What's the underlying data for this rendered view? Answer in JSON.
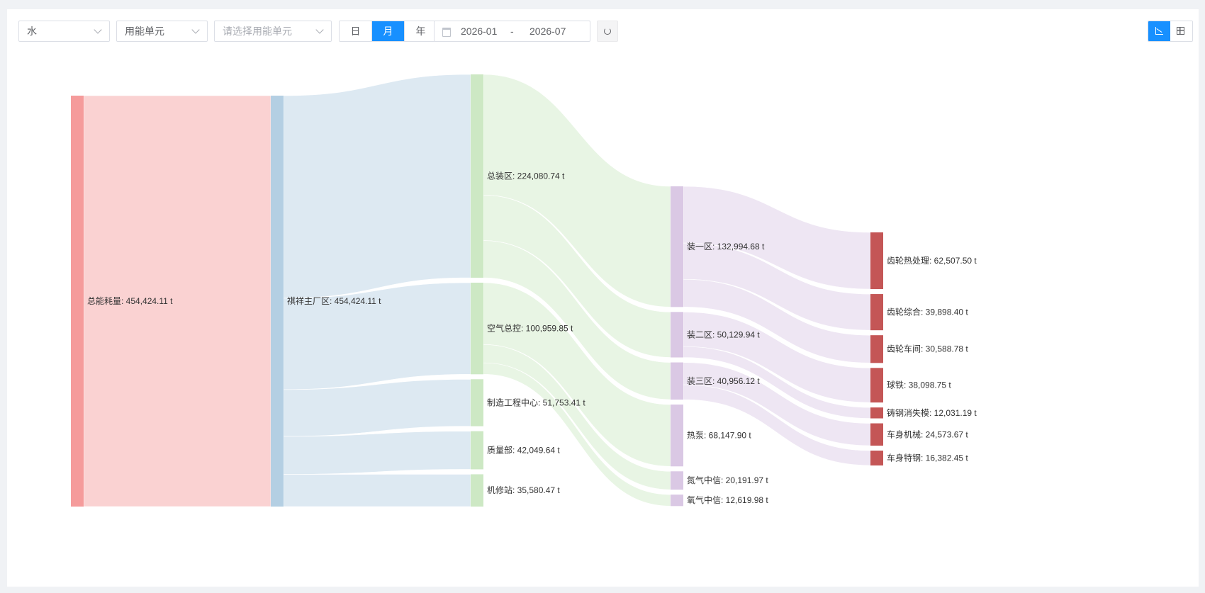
{
  "toolbar": {
    "energy_type": "水",
    "unit_type": "用能单元",
    "unit_placeholder": "请选择用能单元",
    "period_buttons": [
      "日",
      "月",
      "年"
    ],
    "active_period": "月",
    "date_start": "2026-01",
    "date_sep": "-",
    "date_end": "2026-07"
  },
  "colors": {
    "accent": "#1890ff",
    "level0": "#f59b9b",
    "level1": "#b4cfe3",
    "level2": "#cde8c4",
    "level3": "#dac8e4",
    "level4": "#c45656"
  },
  "chart_data": {
    "type": "sankey",
    "unit": "t",
    "nodes": [
      {
        "id": "total",
        "name": "总能耗量",
        "level": 0,
        "value": 454424.11,
        "label": "总能耗量: 454,424.11 t"
      },
      {
        "id": "plant",
        "name": "祺祥主厂区",
        "level": 1,
        "value": 454424.11,
        "label": "祺祥主厂区: 454,424.11 t"
      },
      {
        "id": "assembly",
        "name": "总装区",
        "level": 2,
        "value": 224080.74,
        "label": "总装区: 224,080.74 t"
      },
      {
        "id": "air",
        "name": "空气总控",
        "level": 2,
        "value": 100959.85,
        "label": "空气总控: 100,959.85 t"
      },
      {
        "id": "mfg",
        "name": "制造工程中心",
        "level": 2,
        "value": 51753.41,
        "label": "制造工程中心: 51,753.41 t"
      },
      {
        "id": "quality",
        "name": "质量部",
        "level": 2,
        "value": 42049.64,
        "label": "质量部: 42,049.64 t"
      },
      {
        "id": "repair",
        "name": "机修站",
        "level": 2,
        "value": 35580.47,
        "label": "机修站: 35,580.47 t"
      },
      {
        "id": "z1",
        "name": "装一区",
        "level": 3,
        "value": 132994.68,
        "label": "装一区: 132,994.68 t"
      },
      {
        "id": "z2",
        "name": "装二区",
        "level": 3,
        "value": 50129.94,
        "label": "装二区: 50,129.94 t"
      },
      {
        "id": "z3",
        "name": "装三区",
        "level": 3,
        "value": 40956.12,
        "label": "装三区: 40,956.12 t"
      },
      {
        "id": "pump",
        "name": "热泵",
        "level": 3,
        "value": 68147.9,
        "label": "热泵: 68,147.90 t"
      },
      {
        "id": "n2",
        "name": "氮气中信",
        "level": 3,
        "value": 20191.97,
        "label": "氮气中信: 20,191.97 t"
      },
      {
        "id": "o2",
        "name": "氧气中信",
        "level": 3,
        "value": 12619.98,
        "label": "氧气中信: 12,619.98 t"
      },
      {
        "id": "gearheat",
        "name": "齿轮热处理",
        "level": 4,
        "value": 62507.5,
        "label": "齿轮热处理: 62,507.50 t"
      },
      {
        "id": "gearall",
        "name": "齿轮综合",
        "level": 4,
        "value": 39898.4,
        "label": "齿轮综合: 39,898.40 t"
      },
      {
        "id": "gearshop",
        "name": "齿轮车间",
        "level": 4,
        "value": 30588.78,
        "label": "齿轮车间: 30,588.78 t"
      },
      {
        "id": "iron",
        "name": "球铁",
        "level": 4,
        "value": 38098.75,
        "label": "球铁: 38,098.75 t"
      },
      {
        "id": "cast",
        "name": "铸钢消失模",
        "level": 4,
        "value": 12031.19,
        "label": "铸钢消失模: 12,031.19 t"
      },
      {
        "id": "bodymech",
        "name": "车身机械",
        "level": 4,
        "value": 24573.67,
        "label": "车身机械: 24,573.67 t"
      },
      {
        "id": "bodysteel",
        "name": "车身特钢",
        "level": 4,
        "value": 16382.45,
        "label": "车身特钢: 16,382.45 t"
      }
    ],
    "links": [
      {
        "source": "total",
        "target": "plant",
        "value": 454424.11
      },
      {
        "source": "plant",
        "target": "assembly",
        "value": 224080.74
      },
      {
        "source": "plant",
        "target": "air",
        "value": 100959.85
      },
      {
        "source": "plant",
        "target": "mfg",
        "value": 51753.41
      },
      {
        "source": "plant",
        "target": "quality",
        "value": 42049.64
      },
      {
        "source": "plant",
        "target": "repair",
        "value": 35580.47
      },
      {
        "source": "assembly",
        "target": "z1",
        "value": 132994.68
      },
      {
        "source": "assembly",
        "target": "z2",
        "value": 50129.94
      },
      {
        "source": "assembly",
        "target": "z3",
        "value": 40956.12
      },
      {
        "source": "air",
        "target": "pump",
        "value": 68147.9
      },
      {
        "source": "air",
        "target": "n2",
        "value": 20191.97
      },
      {
        "source": "air",
        "target": "o2",
        "value": 12619.98
      },
      {
        "source": "z1",
        "target": "gearheat",
        "value": 62507.5
      },
      {
        "source": "z1",
        "target": "gearall",
        "value": 39898.4
      },
      {
        "source": "z1",
        "target": "gearshop",
        "value": 30588.78
      },
      {
        "source": "z2",
        "target": "iron",
        "value": 38098.75
      },
      {
        "source": "z2",
        "target": "cast",
        "value": 12031.19
      },
      {
        "source": "z3",
        "target": "bodymech",
        "value": 24573.67
      },
      {
        "source": "z3",
        "target": "bodysteel",
        "value": 16382.45
      }
    ]
  }
}
